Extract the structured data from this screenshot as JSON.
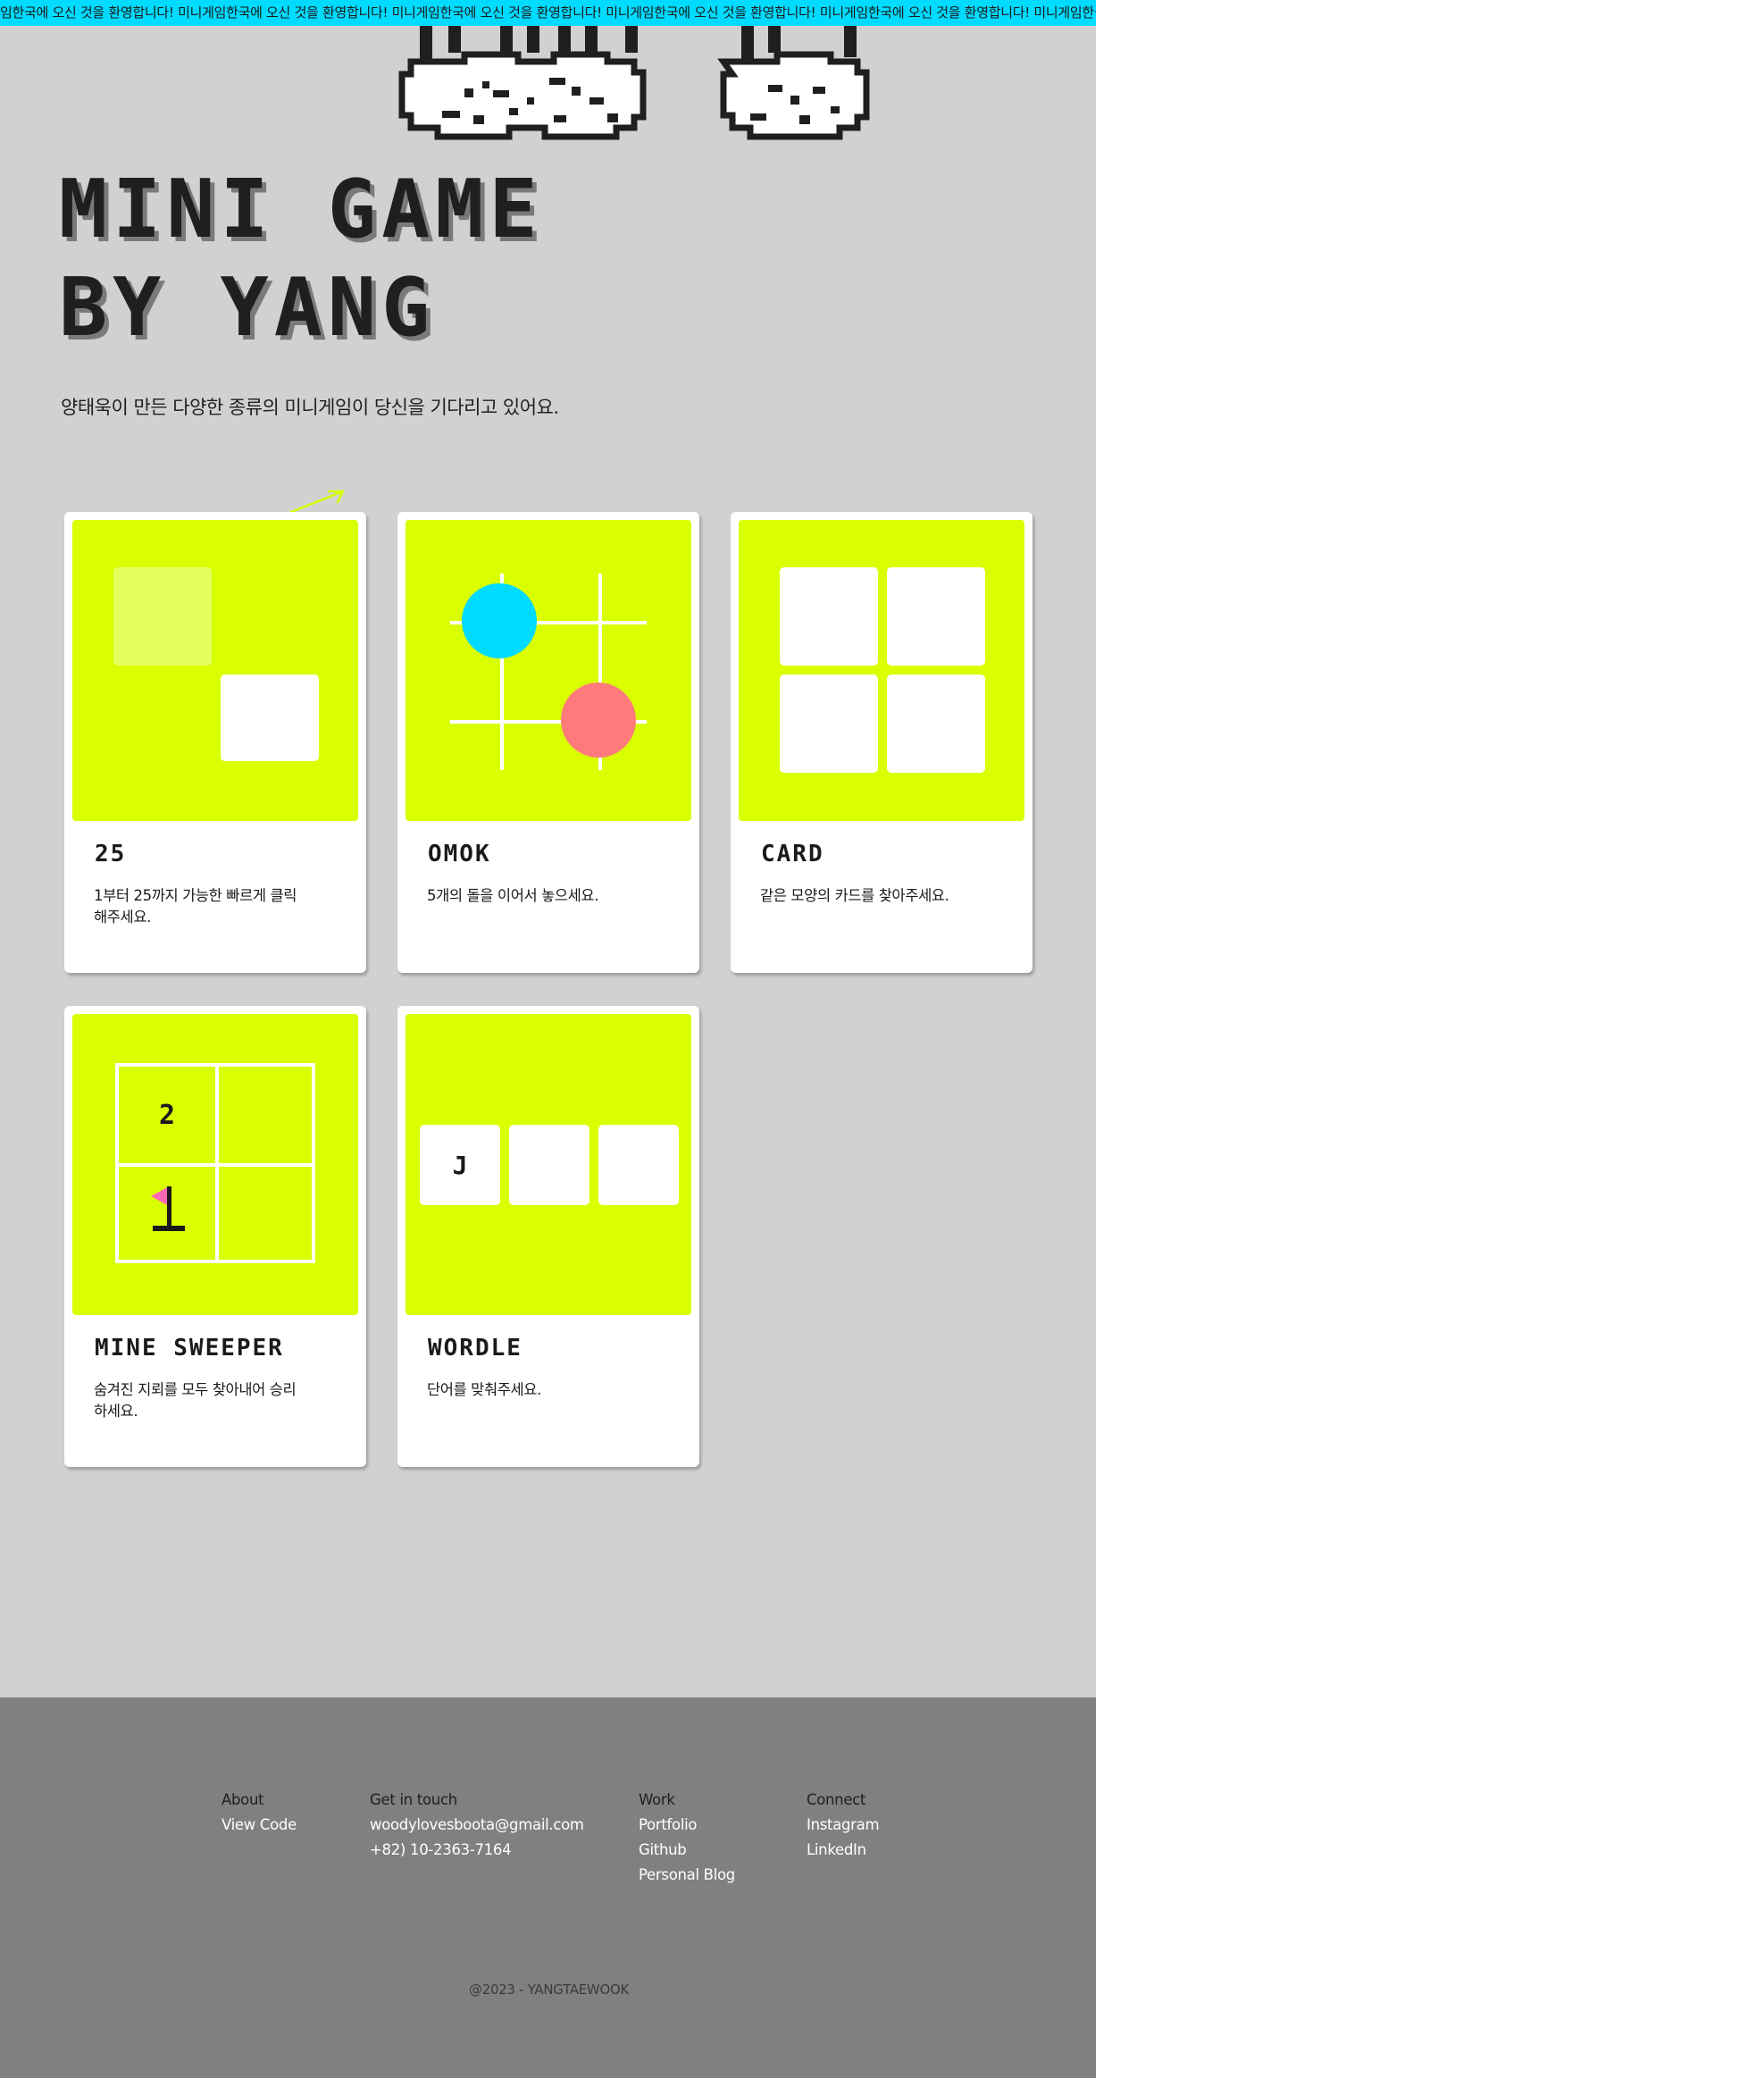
{
  "marquee": {
    "text": "임한국에 오신 것을 환영합니다! 미니게임한국에 오신 것을 환영합니다! 미니게임한국에 오신 것을 환영합니다! 미니게임한국에 오신 것을 환영합니다! 미니게임한국에 오신 것을 환영합니다! 미니게임한국에 오신 것을 환영합니다! 미니"
  },
  "hero": {
    "title_line1": "MINI GAME",
    "title_line2": "BY YANG",
    "subtitle": "양태욱이 만든 다양한 종류의 미니게임이 당신을 기다리고 있어요."
  },
  "games": [
    {
      "title": "25",
      "description": "1부터 25까지 가능한 빠르게 클릭해주세요."
    },
    {
      "title": "OMOK",
      "description": "5개의 돌을 이어서 놓으세요."
    },
    {
      "title": "CARD",
      "description": "같은 모양의 카드를 찾아주세요."
    },
    {
      "title": "MINE SWEEPER",
      "description": "숨겨진 지뢰를 모두 찾아내어 승리하세요."
    },
    {
      "title": "WORDLE",
      "description": "단어를 맞춰주세요."
    }
  ],
  "thumbs": {
    "mine_number": "2",
    "mine_number2": "1",
    "wordle_letter": "J"
  },
  "footer": {
    "about": {
      "heading": "About",
      "links": [
        "View Code"
      ]
    },
    "contact": {
      "heading": "Get in touch",
      "email": "woodylovesboota@gmail.com",
      "phone": "+82) 10-2363-7164"
    },
    "work": {
      "heading": "Work",
      "links": [
        "Portfolio",
        "Github",
        "Personal Blog"
      ]
    },
    "connect": {
      "heading": "Connect",
      "links": [
        "Instagram",
        "LinkedIn"
      ]
    },
    "copyright": "@2023 - YANGTAEWOOK"
  },
  "colors": {
    "accent_lime": "#d9ff00",
    "marquee_cyan": "#00dbff",
    "omok_blue": "#00dbff",
    "omok_red": "#ff7a7a",
    "footer_gray": "#808080",
    "page_gray": "#d1d1d1"
  }
}
